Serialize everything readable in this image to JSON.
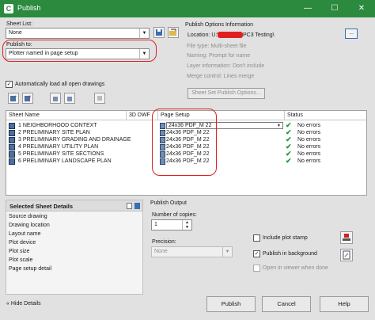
{
  "window": {
    "title": "Publish",
    "app_icon": "C",
    "minimize": "—",
    "maximize": "☐",
    "close": "✕"
  },
  "sheet_list": {
    "label": "Sheet List:",
    "value": "None"
  },
  "publish_to": {
    "label": "Publish to:",
    "value": "Plotter named in page setup"
  },
  "auto_load": {
    "label": "Automatically load all open drawings",
    "checked": true
  },
  "publish_options": {
    "header": "Publish Options Information",
    "location_label": "Location: U:\\",
    "location_suffix": "PC3 Testing\\",
    "file_type": "File type: Multi-sheet file",
    "naming": "Naming: Prompt for name",
    "layer_info": "Layer information: Don't include",
    "merge_control": "Merge control: Lines merge",
    "button": "Sheet Set Publish Options..."
  },
  "table": {
    "headers": [
      "Sheet Name",
      "3D DWF",
      "Page Setup",
      "Status"
    ],
    "rows": [
      {
        "name": "1 NEIGHBORHOOD CONTEXT",
        "page_setup": "24x36 PDF_M 22",
        "status": "No errors"
      },
      {
        "name": "2 PRELIMINARY SITE PLAN",
        "page_setup": "24x36 PDF_M 22",
        "status": "No errors"
      },
      {
        "name": "3 PRELIMINARY GRADING AND DRAINAGE",
        "page_setup": "24x36 PDF_M 22",
        "status": "No errors"
      },
      {
        "name": "4 PRELIMINARY UTILITY PLAN",
        "page_setup": "24x36 PDF_M 22",
        "status": "No errors"
      },
      {
        "name": "5 PRELIMINARY SITE SECTIONS",
        "page_setup": "24x36 PDF_M 22",
        "status": "No errors"
      },
      {
        "name": "6 PRELIMINARY LANDSCAPE PLAN",
        "page_setup": "24x36 PDF_M 22",
        "status": "No errors"
      }
    ]
  },
  "selected_details": {
    "header": "Selected Sheet Details",
    "items": [
      "Source drawing",
      "Drawing location",
      "Layout name",
      "Plot device",
      "Plot size",
      "Plot scale",
      "Page setup detail"
    ]
  },
  "publish_output": {
    "header": "Publish Output",
    "copies_label": "Number of copies:",
    "copies_value": "1",
    "precision_label": "Precision:",
    "precision_value": "None",
    "include_stamp": {
      "label": "Include plot stamp",
      "checked": false
    },
    "publish_bg": {
      "label": "Publish in background",
      "checked": true
    },
    "open_viewer": {
      "label": "Open in viewer when done",
      "checked": false
    }
  },
  "footer": {
    "hide_details": "Hide Details",
    "publish": "Publish",
    "cancel": "Cancel",
    "help": "Help"
  },
  "colors": {
    "title_bar": "#2b8a3e",
    "highlight": "#e02020",
    "status_ok": "#1f9a3a"
  }
}
